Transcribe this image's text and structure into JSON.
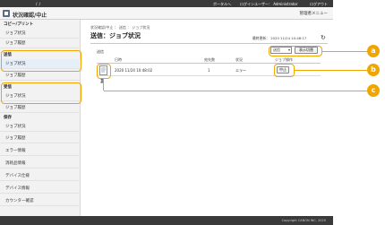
{
  "topbar": {
    "device": "/ /",
    "portal_link": "ポータルへ",
    "login_user": "ログインユーザー： Administrator",
    "logout": "ログアウト"
  },
  "titlebar": {
    "title": "状況確認/中止",
    "management": "管理者メニュー"
  },
  "sidebar": {
    "sections": [
      {
        "heading": "コピー/プリント",
        "items": [
          "ジョブ状況",
          "ジョブ履歴"
        ]
      },
      {
        "heading": "送信",
        "items": [
          "ジョブ状況",
          "ジョブ履歴"
        ]
      },
      {
        "heading": "受信",
        "items": [
          "ジョブ状況",
          "ジョブ履歴"
        ]
      },
      {
        "heading": "保存",
        "items": [
          "ジョブ状況",
          "ジョブ履歴"
        ]
      }
    ],
    "others": [
      "エラー情報",
      "消耗品情報",
      "デバイス仕様",
      "デバイス情報",
      "カウンター確認"
    ]
  },
  "main": {
    "breadcrumb": "状況確認/中止 ： 送信 ： ジョブ状況",
    "page_title": "送信：ジョブ状況",
    "updated": "最終更新： 2020 11/24 10:48:17",
    "filter_label": "送信",
    "select_value": "送信",
    "display_button": "表示切替",
    "table": {
      "headers": [
        "",
        "日時",
        "宛先数",
        "状況",
        "ジョブ操作"
      ],
      "rows": [
        {
          "datetime": "2020 11/24 10:48:02",
          "destinations": "1",
          "status": "エラー",
          "action": "中止"
        }
      ]
    }
  },
  "callouts": [
    "a",
    "b",
    "c"
  ],
  "footer": {
    "copyright": "Copyright CANON INC. 2020"
  },
  "colors": {
    "accent": "#f0a500",
    "topbar": "#3a3a3a"
  }
}
